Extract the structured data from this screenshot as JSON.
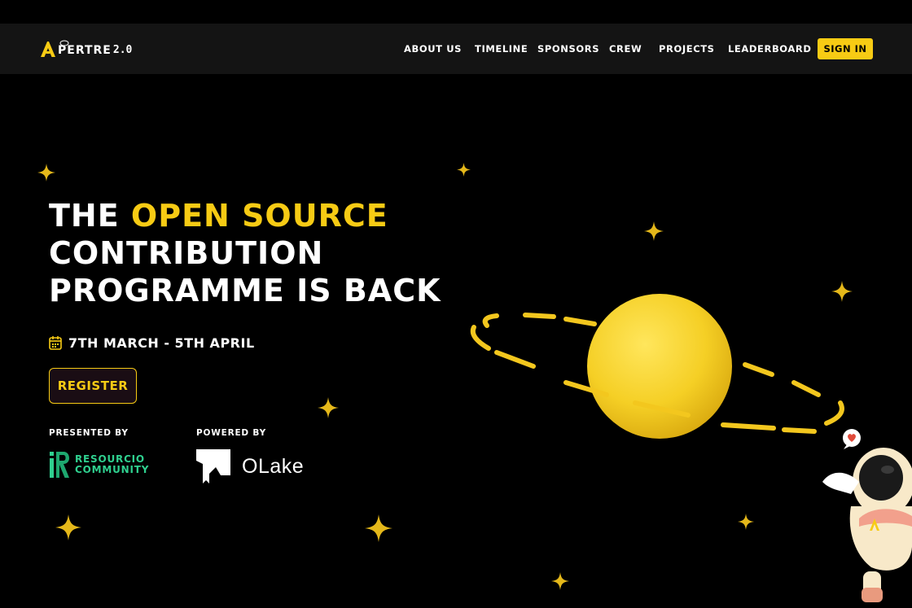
{
  "brand": {
    "logo_text": "PERTRE",
    "version": "2.0",
    "accent_color": "#F7CB14"
  },
  "nav": {
    "items": [
      {
        "label": "About Us"
      },
      {
        "label": "Timeline"
      },
      {
        "label": "Sponsors"
      },
      {
        "label": "Crew"
      },
      {
        "label": "Projects"
      },
      {
        "label": "Leaderboard"
      }
    ],
    "signin_label": "Sign In"
  },
  "hero": {
    "title_line1_prefix": "The",
    "title_line1_accent": "Open Source",
    "title_line2": "Contribution",
    "title_line3": "Programme is Back",
    "date": "7th March - 5th April",
    "register_label": "Register"
  },
  "sponsors": {
    "presented_label": "Presented By",
    "presented_name_line1": "RESOURCIO",
    "presented_name_line2": "COMMUNITY",
    "powered_label": "Powered By",
    "powered_name": "OLake"
  },
  "icons": {
    "calendar": "calendar-icon",
    "star": "sparkle-star-icon",
    "planet": "planet-illustration",
    "astronaut": "astronaut-illustration"
  }
}
